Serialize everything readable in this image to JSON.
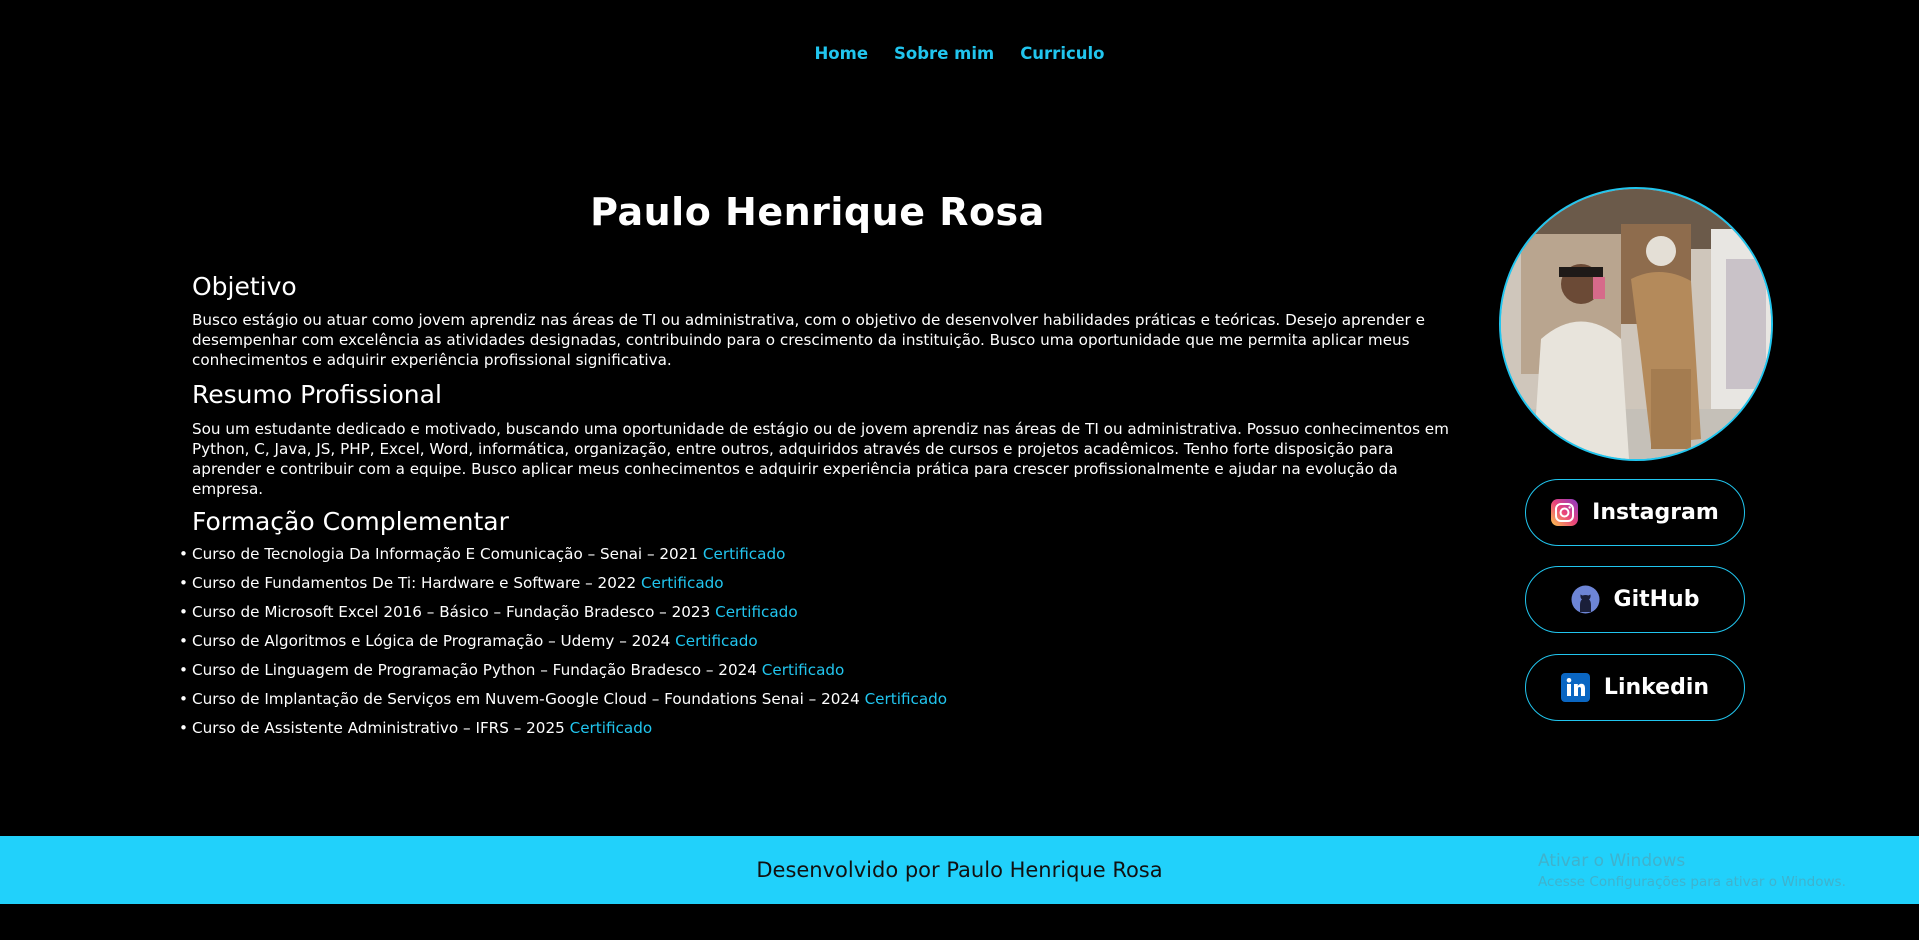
{
  "nav": {
    "items": [
      {
        "label": "Home"
      },
      {
        "label": "Sobre mim"
      },
      {
        "label": "Curriculo"
      }
    ]
  },
  "profile": {
    "name": "Paulo Henrique Rosa"
  },
  "objetivo": {
    "title": "Objetivo",
    "text": "Busco estágio ou atuar como jovem aprendiz nas áreas de TI ou administrativa, com o objetivo de desenvolver habilidades práticas e teóricas. Desejo aprender e desempenhar com excelência as atividades designadas, contribuindo para o crescimento da instituição. Busco uma oportunidade que me permita aplicar meus conhecimentos e adquirir experiência profissional significativa."
  },
  "resumo": {
    "title": "Resumo Profissional",
    "text": "Sou um estudante dedicado e motivado, buscando uma oportunidade de estágio ou de jovem aprendiz nas áreas de TI ou administrativa. Possuo conhecimentos em Python, C, Java, JS, PHP, Excel, Word, informática, organização, entre outros, adquiridos através de cursos e projetos acadêmicos. Tenho forte disposição para aprender e contribuir com a equipe. Busco aplicar meus conhecimentos e adquirir experiência prática para crescer profissionalmente e ajudar na evolução da empresa."
  },
  "formacao": {
    "title": "Formação Complementar",
    "courses": [
      {
        "text": "Curso de Tecnologia Da Informação E Comunicação – Senai – 2021",
        "link": "Certificado"
      },
      {
        "text": "Curso de Fundamentos De Ti: Hardware e Software – 2022",
        "link": "Certificado"
      },
      {
        "text": "Curso de Microsoft Excel 2016 – Básico – Fundação Bradesco – 2023",
        "link": "Certificado"
      },
      {
        "text": "Curso de Algoritmos e Lógica de Programação – Udemy – 2024",
        "link": "Certificado"
      },
      {
        "text": "Curso de Linguagem de Programação Python – Fundação Bradesco – 2024",
        "link": "Certificado"
      },
      {
        "text": "Curso de Implantação de Serviços em Nuvem-Google Cloud – Foundations Senai – 2024",
        "link": "Certificado"
      },
      {
        "text": "Curso de Assistente Administrativo – IFRS – 2025",
        "link": "Certificado"
      }
    ]
  },
  "social": {
    "instagram": {
      "label": "Instagram",
      "icon": "instagram-icon"
    },
    "github": {
      "label": "GitHub",
      "icon": "github-icon"
    },
    "linkedin": {
      "label": "Linkedin",
      "icon": "linkedin-icon"
    }
  },
  "footer": {
    "text": "Desenvolvido por Paulo Henrique Rosa"
  },
  "watermark": {
    "title": "Ativar o Windows",
    "subtitle": "Acesse Configurações para ativar o Windows."
  },
  "colors": {
    "accent": "#21c5ee",
    "footer_bg": "#21d1fb",
    "background": "#000000"
  }
}
